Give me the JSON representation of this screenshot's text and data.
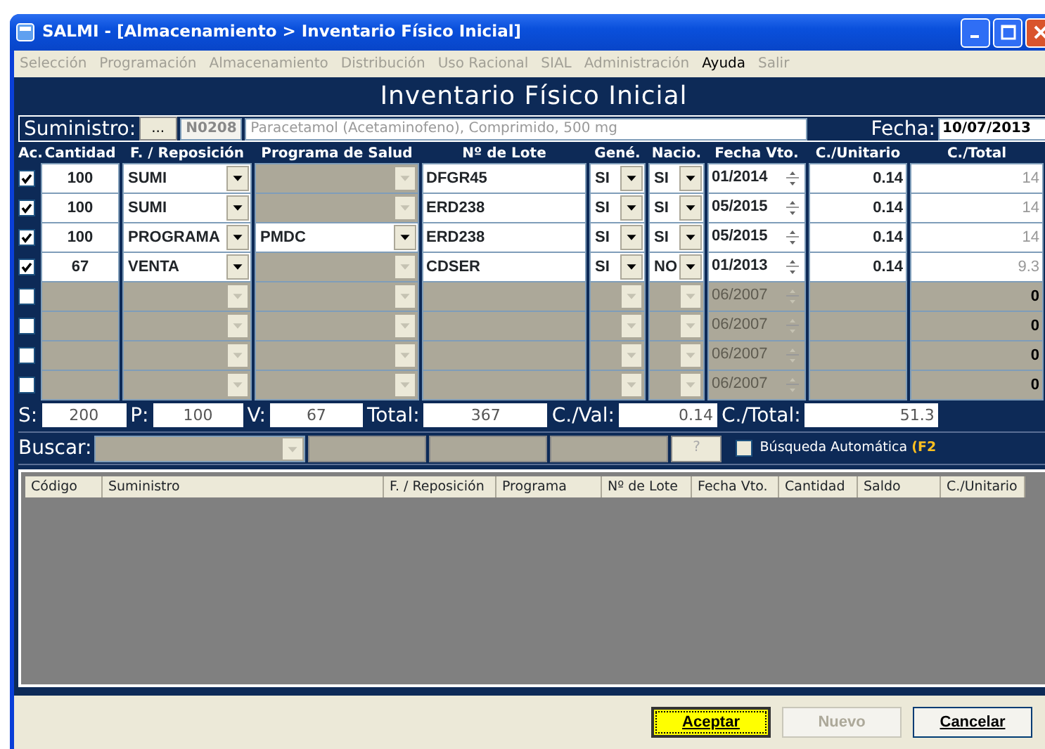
{
  "window": {
    "title": "SALMI - [Almacenamiento > Inventario Físico Inicial]"
  },
  "menu": [
    {
      "label": "Selección",
      "disabled": true
    },
    {
      "label": "Programación",
      "disabled": true
    },
    {
      "label": "Almacenamiento",
      "disabled": true
    },
    {
      "label": "Distribución",
      "disabled": true
    },
    {
      "label": "Uso Racional",
      "disabled": true
    },
    {
      "label": "SIAL",
      "disabled": true
    },
    {
      "label": "Administración",
      "disabled": true
    },
    {
      "label": "Ayuda",
      "disabled": false
    },
    {
      "label": "Salir",
      "disabled": true
    }
  ],
  "form_title": "Inventario Físico Inicial",
  "suministro": {
    "label": "Suministro:",
    "button": "...",
    "code": "N0208",
    "name": "Paracetamol (Acetaminofeno), Comprimido, 500 mg"
  },
  "fecha": {
    "label": "Fecha:",
    "value": "10/07/2013"
  },
  "columns": [
    "Ac.",
    "Cantidad",
    "F. / Reposición",
    "Programa de Salud",
    "Nº de Lote",
    "Gené.",
    "Nacio.",
    "Fecha Vto.",
    "C./Unitario",
    "C./Total"
  ],
  "rows": [
    {
      "checked": true,
      "enabled": true,
      "cantidad": "100",
      "reposicion": "SUMI",
      "programa": "",
      "programa_enabled": false,
      "lote": "DFGR45",
      "gene": "SI",
      "nacio": "SI",
      "fecha_vto": "01/2014",
      "c_unitario": "0.14",
      "c_total": "14"
    },
    {
      "checked": true,
      "enabled": true,
      "cantidad": "100",
      "reposicion": "SUMI",
      "programa": "",
      "programa_enabled": false,
      "lote": "ERD238",
      "gene": "SI",
      "nacio": "SI",
      "fecha_vto": "05/2015",
      "c_unitario": "0.14",
      "c_total": "14"
    },
    {
      "checked": true,
      "enabled": true,
      "cantidad": "100",
      "reposicion": "PROGRAMA",
      "programa": "PMDC",
      "programa_enabled": true,
      "lote": "ERD238",
      "gene": "SI",
      "nacio": "SI",
      "fecha_vto": "05/2015",
      "c_unitario": "0.14",
      "c_total": "14"
    },
    {
      "checked": true,
      "enabled": true,
      "cantidad": "67",
      "reposicion": "VENTA",
      "programa": "",
      "programa_enabled": false,
      "lote": "CDSER",
      "gene": "SI",
      "nacio": "NO",
      "fecha_vto": "01/2013",
      "c_unitario": "0.14",
      "c_total": "9.3"
    },
    {
      "checked": false,
      "enabled": false,
      "cantidad": "",
      "reposicion": "",
      "programa": "",
      "programa_enabled": false,
      "lote": "",
      "gene": "",
      "nacio": "",
      "fecha_vto": "06/2007",
      "c_unitario": "",
      "c_total": "0"
    },
    {
      "checked": false,
      "enabled": false,
      "cantidad": "",
      "reposicion": "",
      "programa": "",
      "programa_enabled": false,
      "lote": "",
      "gene": "",
      "nacio": "",
      "fecha_vto": "06/2007",
      "c_unitario": "",
      "c_total": "0"
    },
    {
      "checked": false,
      "enabled": false,
      "cantidad": "",
      "reposicion": "",
      "programa": "",
      "programa_enabled": false,
      "lote": "",
      "gene": "",
      "nacio": "",
      "fecha_vto": "06/2007",
      "c_unitario": "",
      "c_total": "0"
    },
    {
      "checked": false,
      "enabled": false,
      "cantidad": "",
      "reposicion": "",
      "programa": "",
      "programa_enabled": false,
      "lote": "",
      "gene": "",
      "nacio": "",
      "fecha_vto": "06/2007",
      "c_unitario": "",
      "c_total": "0"
    }
  ],
  "totals": [
    {
      "label": "S:",
      "value": "200"
    },
    {
      "label": "P:",
      "value": "100"
    },
    {
      "label": "V:",
      "value": "67"
    },
    {
      "label": "Total:",
      "value": "367"
    },
    {
      "label": "C./Val:",
      "value": "0.14"
    },
    {
      "label": "C./Total:",
      "value": "51.3"
    }
  ],
  "buscar": {
    "label": "Buscar:",
    "help_button": "?",
    "auto_search": {
      "label": "Búsqueda Automática **(F2**",
      "checked": false
    }
  },
  "results_columns": [
    "Código",
    "Suministro",
    "F. / Reposición",
    "Programa",
    "Nº de Lote",
    "Fecha Vto.",
    "Cantidad",
    "Saldo",
    "C./Unitario"
  ],
  "buttons": [
    {
      "label": "Aceptar",
      "kind": "default"
    },
    {
      "label": "Nuevo",
      "kind": "disabled"
    },
    {
      "label": "Cancelar",
      "kind": "normal"
    }
  ]
}
